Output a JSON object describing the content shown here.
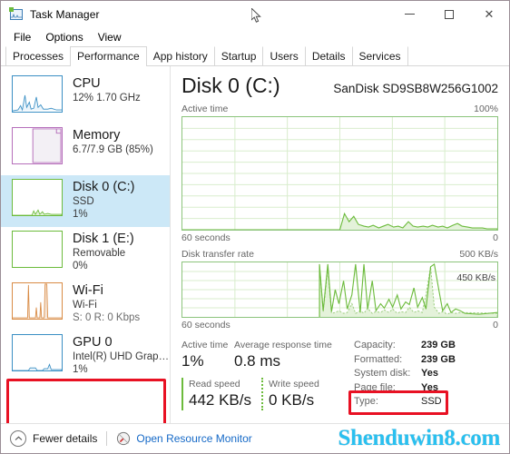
{
  "window": {
    "title": "Task Manager",
    "icon": "task-manager-icon",
    "controls": {
      "minimize": "–",
      "maximize": "□",
      "close": "✕"
    }
  },
  "menu": {
    "items": [
      "File",
      "Options",
      "View"
    ]
  },
  "tabs": {
    "items": [
      "Processes",
      "Performance",
      "App history",
      "Startup",
      "Users",
      "Details",
      "Services"
    ],
    "active": "Performance"
  },
  "sidebar": {
    "items": [
      {
        "title": "CPU",
        "sub1": "12%  1.70 GHz",
        "sub2": "",
        "color": "#3a8fc4",
        "selected": false,
        "highlight": false
      },
      {
        "title": "Memory",
        "sub1": "6.7/7.9 GB (85%)",
        "sub2": "",
        "color": "#b66fbb",
        "selected": false,
        "highlight": false
      },
      {
        "title": "Disk 0 (C:)",
        "sub1": "SSD",
        "sub2": "1%",
        "color": "#6cbb3c",
        "selected": true,
        "highlight": false
      },
      {
        "title": "Disk 1 (E:)",
        "sub1": "Removable",
        "sub2": "0%",
        "color": "#6cbb3c",
        "selected": false,
        "highlight": false
      },
      {
        "title": "Wi-Fi",
        "sub1": "Wi-Fi",
        "sub2": "S: 0 R: 0 Kbps",
        "color": "#d98b45",
        "selected": false,
        "highlight": false
      },
      {
        "title": "GPU 0",
        "sub1": "Intel(R) UHD Graphic...",
        "sub2": "1%",
        "color": "#3a8fc4",
        "selected": false,
        "highlight": true
      }
    ],
    "highlight_color": "#e81123"
  },
  "main": {
    "title": "Disk 0 (C:)",
    "model": "SanDisk SD9SB8W256G1002"
  },
  "chart_data": [
    {
      "type": "area",
      "title": "Active time",
      "ymax_label": "100%",
      "ymin_label": "0",
      "xlabel": "60 seconds",
      "ylim": [
        0,
        100
      ],
      "grid": {
        "rows": 10,
        "cols": 6
      },
      "line_color": "#6cbb3c",
      "fill_color": "#e2f1d8",
      "values": [
        0,
        0,
        0,
        0,
        0,
        0,
        0,
        0,
        0,
        0,
        0,
        0,
        0,
        0,
        0,
        0,
        0,
        0,
        0,
        0,
        0,
        0,
        0,
        0,
        0,
        0,
        0,
        0,
        0,
        0,
        0,
        0,
        14,
        8,
        11,
        5,
        3,
        2,
        2,
        4,
        2,
        3,
        5,
        2,
        3,
        2,
        9,
        3,
        2,
        2,
        2,
        3,
        2,
        4,
        3,
        2,
        4,
        6,
        3,
        2,
        2,
        2,
        1,
        1
      ]
    },
    {
      "type": "line",
      "title": "Disk transfer rate",
      "ymax_label": "500 KB/s",
      "ymin_label": "0",
      "xlabel": "60 seconds",
      "annotation": "450 KB/s",
      "ylim": [
        0,
        500
      ],
      "grid": {
        "rows": 6,
        "cols": 6
      },
      "line_color": "#6cbb3c",
      "fill_color": "#e2f1d8",
      "series": [
        {
          "name": "read",
          "values": [
            0,
            0,
            0,
            0,
            0,
            0,
            0,
            0,
            0,
            0,
            0,
            0,
            0,
            0,
            0,
            0,
            0,
            0,
            0,
            0,
            0,
            0,
            0,
            0,
            0,
            0,
            0,
            0,
            500,
            60,
            500,
            50,
            250,
            120,
            330,
            70,
            200,
            500,
            40,
            500,
            70,
            330,
            60,
            120,
            80,
            160,
            90,
            200,
            70,
            140,
            110,
            260,
            90,
            180,
            70,
            460,
            500,
            240,
            60,
            120,
            40,
            90,
            60
          ]
        },
        {
          "name": "write",
          "values": [
            0,
            0,
            0,
            0,
            0,
            0,
            0,
            0,
            0,
            0,
            0,
            0,
            0,
            0,
            0,
            0,
            0,
            0,
            0,
            0,
            0,
            0,
            0,
            0,
            0,
            0,
            0,
            0,
            480,
            30,
            420,
            20,
            40,
            30,
            50,
            20,
            40,
            120,
            30,
            60,
            20,
            80,
            25,
            45,
            30,
            60,
            35,
            70,
            25,
            50,
            40,
            90,
            35,
            60,
            30,
            200,
            460,
            90,
            25,
            50,
            20,
            40,
            30
          ]
        }
      ]
    }
  ],
  "stats": {
    "active_time_label": "Active time",
    "active_time_value": "1%",
    "avg_response_label": "Average response time",
    "avg_response_value": "0.8 ms",
    "read_speed_label": "Read speed",
    "read_speed_value": "442 KB/s",
    "write_speed_label": "Write speed",
    "write_speed_value": "0 KB/s",
    "info": [
      {
        "key": "Capacity:",
        "value": "239 GB",
        "bold": true
      },
      {
        "key": "Formatted:",
        "value": "239 GB",
        "bold": true
      },
      {
        "key": "System disk:",
        "value": "Yes",
        "bold": true
      },
      {
        "key": "Page file:",
        "value": "Yes",
        "bold": true
      },
      {
        "key": "Type:",
        "value": "SSD",
        "bold": false
      }
    ]
  },
  "footer": {
    "fewer_details": "Fewer details",
    "open_resource_monitor": "Open Resource Monitor",
    "link_color": "#1569c7"
  },
  "watermark": {
    "text": "Shenduwin8.com",
    "color": "#29c0f0"
  }
}
